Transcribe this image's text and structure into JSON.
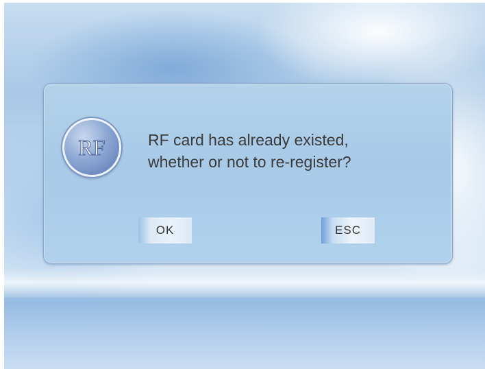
{
  "dialog": {
    "icon": {
      "name": "rf-card-icon",
      "label": "RF"
    },
    "message": {
      "line1": "RF card has already existed,",
      "line2": "whether or not to re-register?"
    },
    "buttons": {
      "ok_label": "OK",
      "esc_label": "ESC"
    }
  },
  "colors": {
    "dialog_background": "#acccE8",
    "text": "#3a3a3a",
    "icon_blue": "#5874b2"
  }
}
